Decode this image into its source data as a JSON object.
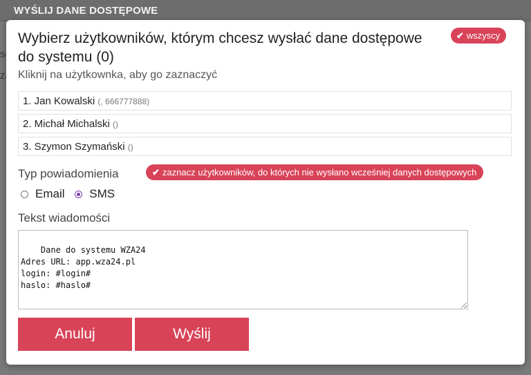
{
  "backdrop": {
    "title": "WYŚLIJ DANE DOSTĘPOWE",
    "fragment_left": "se",
    "fragment_left2": "za"
  },
  "modal": {
    "title": "Wybierz użytkowników, którym chcesz wysłać dane dostępowe do systemu (0)",
    "select_all_label": "wszyscy",
    "hint": "Kliknij na użytkownka, aby go zaznaczyć",
    "users": [
      {
        "name": "1. Jan Kowalski",
        "extra": "(, 666777888)"
      },
      {
        "name": "2. Michał Michalski",
        "extra": "()"
      },
      {
        "name": "3. Szymon Szymański",
        "extra": "()"
      }
    ],
    "notification_label": "Typ powiadomienia",
    "select_unsent_label": "zaznacz użytkowników, do których nie wysłano wcześniej danych dostępowych",
    "options": {
      "email": "Email",
      "sms": "SMS",
      "selected": "SMS"
    },
    "message_label": "Tekst wiadomości",
    "message_text": "Dane do systemu WZA24\nAdres URL: app.wza24.pl\nlogin: #login#\nhaslo: #haslo#",
    "cancel_label": "Anuluj",
    "send_label": "Wyślij"
  },
  "colors": {
    "accent": "#d94358",
    "radio_checked": "#7d3ab0"
  },
  "icons": {
    "check": "check-icon"
  }
}
